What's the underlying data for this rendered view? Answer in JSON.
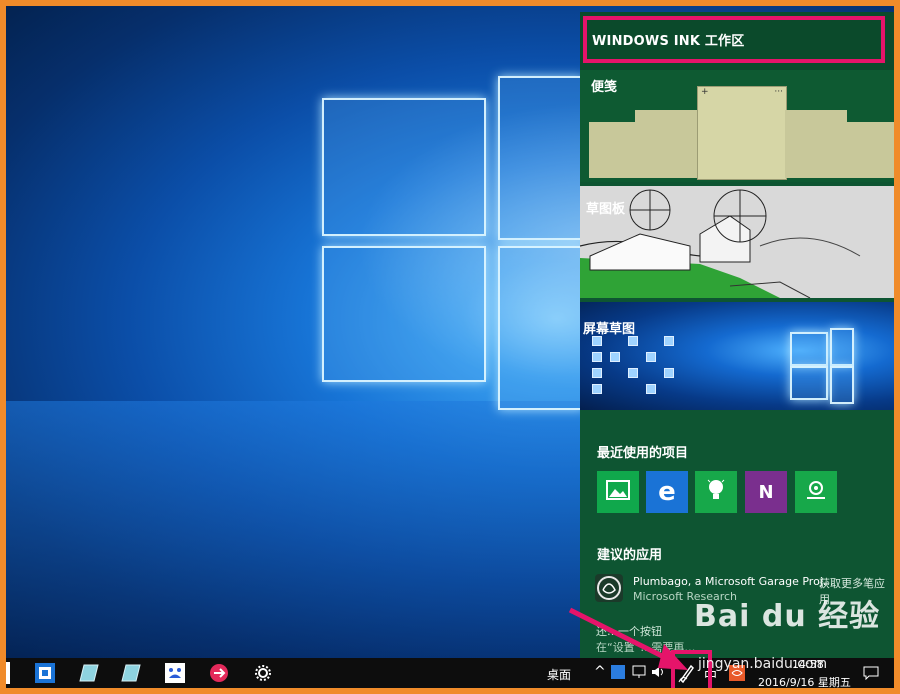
{
  "ink_panel": {
    "title": "WINDOWS INK 工作区",
    "sticky_notes": {
      "label": "便笺",
      "note_plus": "+",
      "note_more": "···"
    },
    "sketchpad": {
      "label": "草图板"
    },
    "screen_sketch": {
      "label": "屏幕草图"
    },
    "recent": {
      "heading": "最近使用的项目",
      "apps": [
        {
          "icon": "photos-icon",
          "color": "#10a84c"
        },
        {
          "icon": "edge-icon",
          "color": "#1a73d6"
        },
        {
          "icon": "tips-icon",
          "color": "#17a84a"
        },
        {
          "icon": "onenote-icon",
          "color": "#7a2f8e"
        },
        {
          "icon": "maps-icon",
          "color": "#17a84a"
        }
      ]
    },
    "suggested": {
      "heading": "建议的应用",
      "app_name": "Plumbago, a Microsoft Garage Proj...",
      "publisher": "Microsoft Research",
      "get_more": "获取更多笔应用"
    },
    "tip_line1": "还…一个按钮",
    "tip_line2": "在“设置”…需要再…"
  },
  "taskbar": {
    "desktop_label": "桌面",
    "ime": "中",
    "time": "14:58",
    "date": "2016/9/16 星期五"
  },
  "watermark": {
    "logo": "Bai du 经验",
    "url": "jingyan.baidu.com"
  },
  "colors": {
    "highlight": "#e5146a",
    "panel_bg": "#0e5532",
    "border": "#f08b2a"
  }
}
